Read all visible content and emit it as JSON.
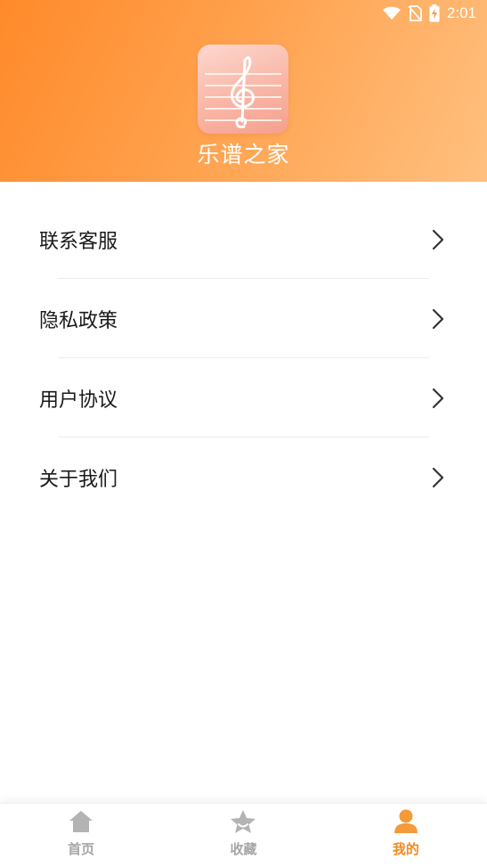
{
  "status_bar": {
    "time": "2:01"
  },
  "header": {
    "app_name": "乐谱之家",
    "logo_icon": "treble-clef-icon"
  },
  "menu": {
    "items": [
      {
        "label": "联系客服"
      },
      {
        "label": "隐私政策"
      },
      {
        "label": "用户协议"
      },
      {
        "label": "关于我们"
      }
    ]
  },
  "tabbar": {
    "tabs": [
      {
        "label": "首页",
        "icon": "home-icon",
        "active": false
      },
      {
        "label": "收藏",
        "icon": "star-icon",
        "active": false
      },
      {
        "label": "我的",
        "icon": "person-icon",
        "active": true
      }
    ]
  },
  "colors": {
    "header_start": "#ff8a2a",
    "header_end": "#ffc07f",
    "accent": "#f08a22",
    "inactive": "#a6a6a6"
  }
}
